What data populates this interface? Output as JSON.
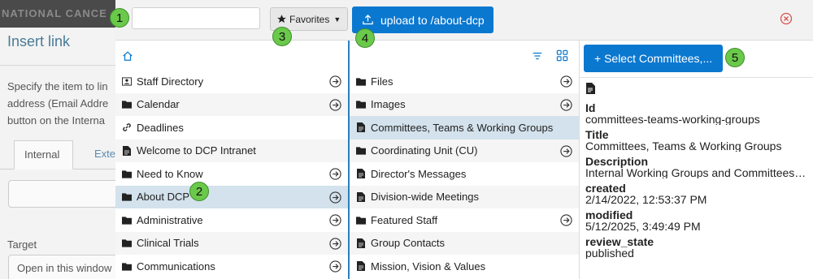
{
  "background_dialog": {
    "header_text": "NATIONAL CANCE",
    "title": "Insert link",
    "description_lines": [
      "Specify the item to lin",
      "address (Email Addre",
      "button on the Interna"
    ],
    "tabs": [
      "Internal",
      "Exte"
    ],
    "target_label": "Target",
    "target_value": "Open in this window"
  },
  "toolbar": {
    "search_value": "",
    "favorites_label": "Favorites",
    "upload_label": "upload to /about-dcp"
  },
  "column1": {
    "items": [
      {
        "label": "Staff Directory",
        "icon": "contact-card-icon",
        "has_children": true
      },
      {
        "label": "Calendar",
        "icon": "folder-icon",
        "has_children": true
      },
      {
        "label": "Deadlines",
        "icon": "link-icon",
        "has_children": false
      },
      {
        "label": "Welcome to DCP Intranet",
        "icon": "document-icon",
        "has_children": false
      },
      {
        "label": "Need to Know",
        "icon": "folder-icon",
        "has_children": true
      },
      {
        "label": "About DCP",
        "icon": "folder-icon",
        "has_children": true,
        "selected": true
      },
      {
        "label": "Administrative",
        "icon": "folder-icon",
        "has_children": true
      },
      {
        "label": "Clinical Trials",
        "icon": "folder-icon",
        "has_children": true
      },
      {
        "label": "Communications",
        "icon": "folder-icon",
        "has_children": true
      }
    ]
  },
  "column2": {
    "items": [
      {
        "label": "Files",
        "icon": "folder-icon",
        "has_children": true
      },
      {
        "label": "Images",
        "icon": "folder-icon",
        "has_children": true
      },
      {
        "label": "Committees, Teams & Working Groups",
        "icon": "document-icon",
        "has_children": false,
        "selected": true
      },
      {
        "label": "Coordinating Unit (CU)",
        "icon": "folder-icon",
        "has_children": true
      },
      {
        "label": "Director's Messages",
        "icon": "document-icon",
        "has_children": false
      },
      {
        "label": "Division-wide Meetings",
        "icon": "document-icon",
        "has_children": false
      },
      {
        "label": "Featured Staff",
        "icon": "folder-icon",
        "has_children": true
      },
      {
        "label": "Group Contacts",
        "icon": "document-icon",
        "has_children": false
      },
      {
        "label": "Mission, Vision & Values",
        "icon": "document-icon",
        "has_children": false
      }
    ]
  },
  "details": {
    "select_button_label": "+ Select Committees,...",
    "fields": [
      {
        "key": "Id",
        "value": "committees-teams-working-groups"
      },
      {
        "key": "Title",
        "value": "Committees, Teams & Working Groups"
      },
      {
        "key": "Description",
        "value": "Internal Working Groups and Committees…"
      },
      {
        "key": "created",
        "value": "2/14/2022, 12:53:37 PM"
      },
      {
        "key": "modified",
        "value": "5/12/2025, 3:49:49 PM"
      },
      {
        "key": "review_state",
        "value": "published"
      }
    ]
  },
  "badges": [
    "1",
    "2",
    "3",
    "4",
    "5"
  ],
  "colors": {
    "accent": "#0b78d0",
    "selected_row": "#d3e2ec",
    "badge": "#6ac94a",
    "close": "#d9534f"
  }
}
